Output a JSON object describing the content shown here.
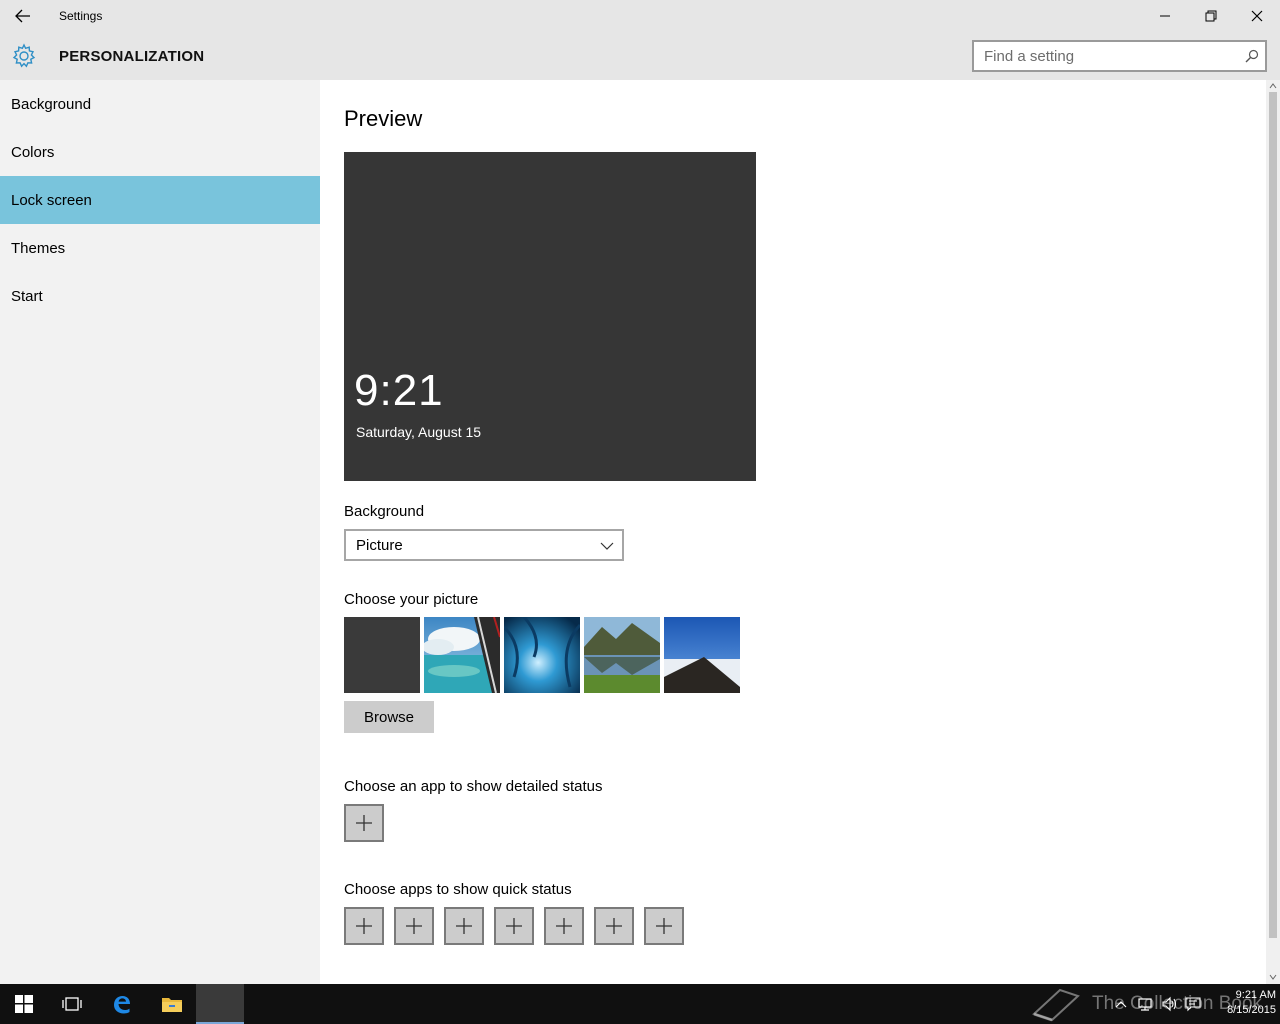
{
  "window": {
    "title": "Settings"
  },
  "header": {
    "title": "PERSONALIZATION",
    "search_placeholder": "Find a setting"
  },
  "sidebar": {
    "items": [
      {
        "label": "Background",
        "selected": false
      },
      {
        "label": "Colors",
        "selected": false
      },
      {
        "label": "Lock screen",
        "selected": true
      },
      {
        "label": "Themes",
        "selected": false
      },
      {
        "label": "Start",
        "selected": false
      }
    ]
  },
  "main": {
    "preview_title": "Preview",
    "preview_time": "9:21",
    "preview_date": "Saturday, August 15",
    "background_label": "Background",
    "background_value": "Picture",
    "choose_picture_label": "Choose your picture",
    "browse_label": "Browse",
    "detailed_status_label": "Choose an app to show detailed status",
    "quick_status_label": "Choose apps to show quick status",
    "quick_status_slots": 7
  },
  "taskbar": {
    "time": "9:21 AM",
    "date": "8/15/2015",
    "watermark": "The Collection Book"
  },
  "colors": {
    "accent": "#79c4dc",
    "gear": "#2f8fc6",
    "preview_bg": "#363636"
  }
}
